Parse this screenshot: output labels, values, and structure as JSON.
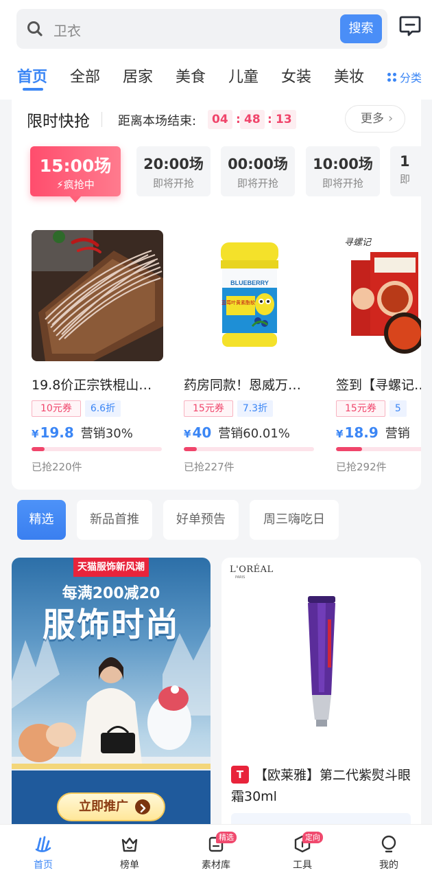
{
  "search": {
    "placeholder": "卫衣",
    "button_label": "搜索"
  },
  "tabs": [
    {
      "label": "首页",
      "active": true
    },
    {
      "label": "全部"
    },
    {
      "label": "居家"
    },
    {
      "label": "美食"
    },
    {
      "label": "儿童"
    },
    {
      "label": "女装"
    },
    {
      "label": "美妆"
    }
  ],
  "category_label": "分类",
  "flash_sale": {
    "title": "限时快抢",
    "ends_label": "距离本场结束:",
    "countdown": {
      "h": "04",
      "m": "48",
      "s": "13"
    },
    "more_label": "更多",
    "sessions": [
      {
        "time": "15:00场",
        "status": "疯抢中",
        "active": true
      },
      {
        "time": "20:00场",
        "status": "即将开抢"
      },
      {
        "time": "00:00场",
        "status": "即将开抢"
      },
      {
        "time": "10:00场",
        "status": "即将开抢"
      },
      {
        "time": "1",
        "status": "即"
      }
    ],
    "products": [
      {
        "name": "19.8价正宗铁棍山…",
        "coupon": "10元券",
        "discount": "6.6折",
        "currency": "¥",
        "price": "19.8",
        "sales": "营销30%",
        "progress": 0.1,
        "sold": "已抢220件"
      },
      {
        "name": "药房同款！恩威万…",
        "coupon": "15元券",
        "discount": "7.3折",
        "currency": "¥",
        "price": "40",
        "sales": "营销60.01%",
        "progress": 0.1,
        "sold": "已抢227件"
      },
      {
        "name": "签到【寻螺记…",
        "coupon": "15元券",
        "discount": "5",
        "currency": "¥",
        "price": "18.9",
        "sales": "营销",
        "progress": 0.2,
        "sold": "已抢292件"
      }
    ],
    "product_image_text": {
      "bottle_brand": "BLUEBERRY",
      "bottle_label": "蓝莓叶黄素酯软糖",
      "noodle_brand": "寻螺记"
    }
  },
  "chips": [
    {
      "label": "精选",
      "active": true
    },
    {
      "label": "新品首推"
    },
    {
      "label": "好单预告"
    },
    {
      "label": "周三嗨吃日"
    }
  ],
  "feed": {
    "left": {
      "tag": "天猫服饰新风潮",
      "sub": "每满200减20",
      "main": "服饰时尚",
      "button": "立即推广"
    },
    "right": {
      "brand": "L'ORÉAL",
      "brand_sub": "PARIS",
      "badge": "T",
      "title": "【欧莱雅】第二代紫熨斗眼霜30ml"
    }
  },
  "bottom_nav": [
    {
      "label": "首页",
      "icon": "home-icon",
      "active": true
    },
    {
      "label": "榜单",
      "icon": "ranking-icon"
    },
    {
      "label": "素材库",
      "icon": "material-icon",
      "badge": "精选"
    },
    {
      "label": "工具",
      "icon": "tool-icon",
      "badge": "定向"
    },
    {
      "label": "我的",
      "icon": "profile-icon"
    }
  ],
  "colors": {
    "accent": "#3b86f5",
    "sale": "#f0456b",
    "tmall": "#e8243b"
  }
}
